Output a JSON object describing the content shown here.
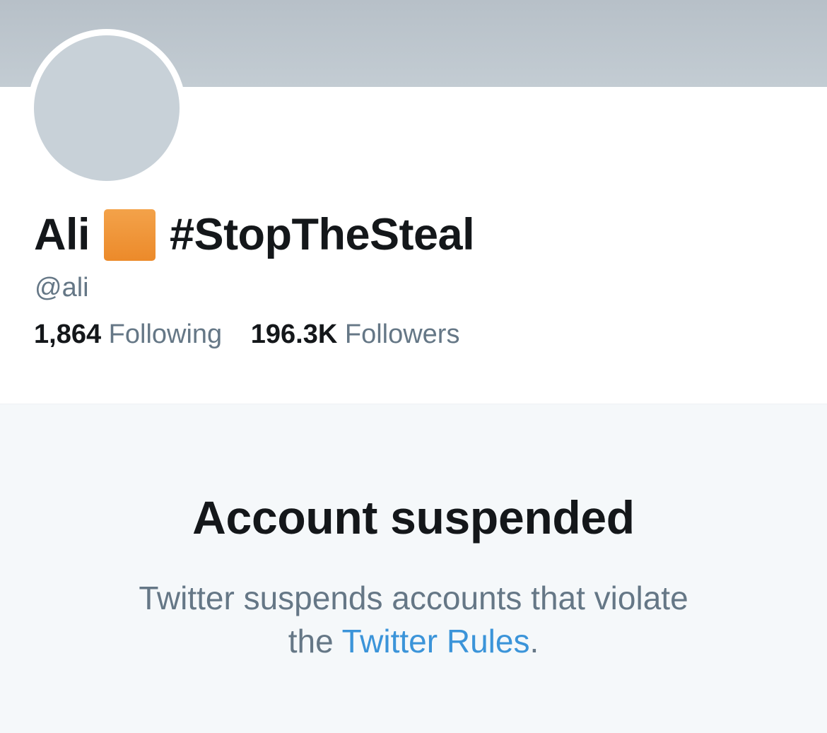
{
  "profile": {
    "display_name": "Ali",
    "hashtag": "#StopTheSteal",
    "handle": "@ali",
    "name_square_icon": "orange-square-emoji",
    "stats": {
      "following_count": "1,864",
      "following_label": "Following",
      "followers_count": "196.3K",
      "followers_label": "Followers"
    }
  },
  "suspension": {
    "title": "Account suspended",
    "message_before": "Twitter suspends accounts that violate",
    "message_the": "the",
    "rules_link": "Twitter Rules",
    "message_after": "."
  },
  "colors": {
    "banner": "#b7c0c8",
    "avatar": "#c8d1d8",
    "name_square": "#f0932f",
    "text_primary": "#14171a",
    "text_secondary": "#657786",
    "link": "#3b94d9",
    "panel_background": "#f5f8fa"
  }
}
